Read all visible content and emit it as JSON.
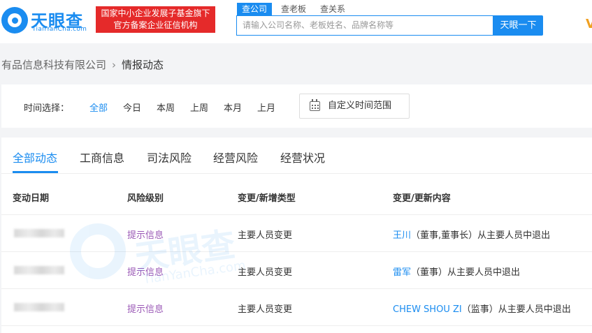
{
  "header": {
    "logo_text": "天眼查",
    "logo_sub": "TianYanCha.com",
    "badge_line1": "国家中小企业发展子基金旗下",
    "badge_line2": "官方备案企业征信机构",
    "search_tabs": [
      "查公司",
      "查老板",
      "查关系"
    ],
    "search_placeholder": "请输入公司名称、老板姓名、品牌名称等",
    "search_button": "天眼一下",
    "vip_partial": "V"
  },
  "breadcrumb": {
    "company": "有品信息科技有限公司",
    "current": "情报动态"
  },
  "filter": {
    "label": "时间选择：",
    "options": [
      "全部",
      "今日",
      "本周",
      "上周",
      "本月",
      "上月"
    ],
    "active_option": "全部",
    "custom_range": "自定义时间范围"
  },
  "tabs": [
    "全部动态",
    "工商信息",
    "司法风险",
    "经营风险",
    "经营状况"
  ],
  "active_tab": "全部动态",
  "table": {
    "headers": [
      "变动日期",
      "风险级别",
      "变更/新增类型",
      "变更/更新内容"
    ],
    "rows": [
      {
        "risk": "提示信息",
        "type": "主要人员变更",
        "person": "王川",
        "role": "（董事,董事长）",
        "action": "从主要人员中退出"
      },
      {
        "risk": "提示信息",
        "type": "主要人员变更",
        "person": "雷军",
        "role": "（董事）",
        "action": "从主要人员中退出"
      },
      {
        "risk": "提示信息",
        "type": "主要人员变更",
        "person": "CHEW SHOU ZI",
        "role": "（监事）",
        "action": "从主要人员中退出"
      }
    ]
  },
  "watermark": {
    "text": "天眼查",
    "sub": "TianYanCha.com"
  },
  "colors": {
    "accent": "#1a8cf0",
    "badge": "#e52a2a",
    "risk": "#9b59b6"
  }
}
